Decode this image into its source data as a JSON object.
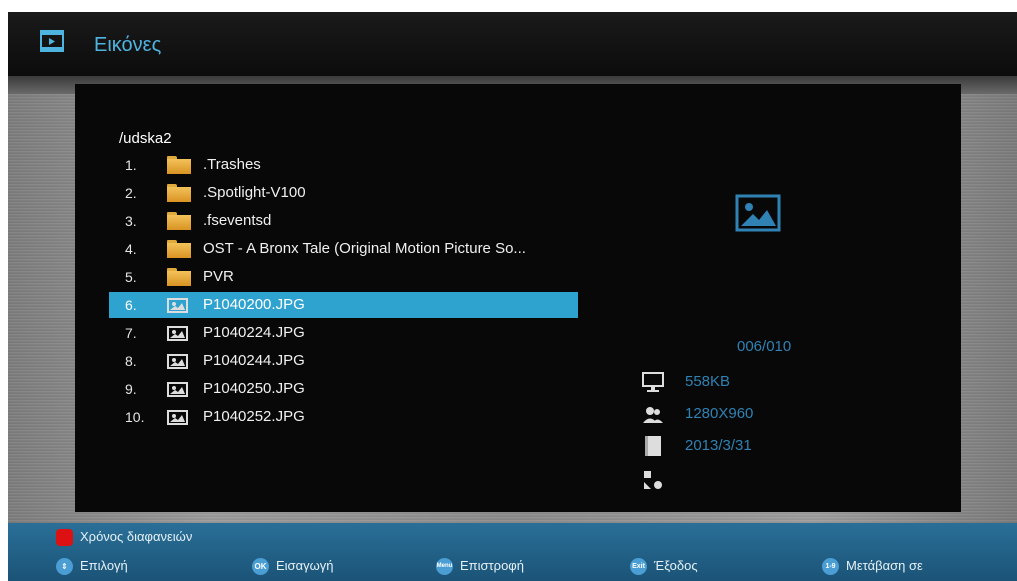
{
  "header": {
    "title": "Εικόνες",
    "icon": "video-icon"
  },
  "browser": {
    "path": "/udska2",
    "selected_index": 5,
    "items": [
      {
        "num": "1.",
        "type": "folder",
        "name": ".Trashes"
      },
      {
        "num": "2.",
        "type": "folder",
        "name": ".Spotlight-V100"
      },
      {
        "num": "3.",
        "type": "folder",
        "name": ".fseventsd"
      },
      {
        "num": "4.",
        "type": "folder",
        "name": "OST - A Bronx Tale (Original Motion Picture So..."
      },
      {
        "num": "5.",
        "type": "folder",
        "name": "PVR"
      },
      {
        "num": "6.",
        "type": "image",
        "name": "P1040200.JPG"
      },
      {
        "num": "7.",
        "type": "image",
        "name": "P1040224.JPG"
      },
      {
        "num": "8.",
        "type": "image",
        "name": "P1040244.JPG"
      },
      {
        "num": "9.",
        "type": "image",
        "name": "P1040250.JPG"
      },
      {
        "num": "10.",
        "type": "image",
        "name": "P1040252.JPG"
      }
    ]
  },
  "info": {
    "counter": "006/010",
    "size": "558KB",
    "resolution": "1280X960",
    "date": "2013/3/31"
  },
  "footer": {
    "red_label": "Χρόνος διαφανειών",
    "select_label": "Επιλογή",
    "ok_key": "OK",
    "ok_label": "Εισαγωγή",
    "menu_key": "Menu",
    "menu_label": "Επιστροφή",
    "exit_key": "Exit",
    "exit_label": "Έξοδος",
    "num_key": "1-9",
    "num_label": "Μετάβαση σε"
  },
  "colors": {
    "accent": "#2fa3cf",
    "info_text": "#2f82b3",
    "title": "#4fb3df",
    "footer": "#1f5d86"
  }
}
